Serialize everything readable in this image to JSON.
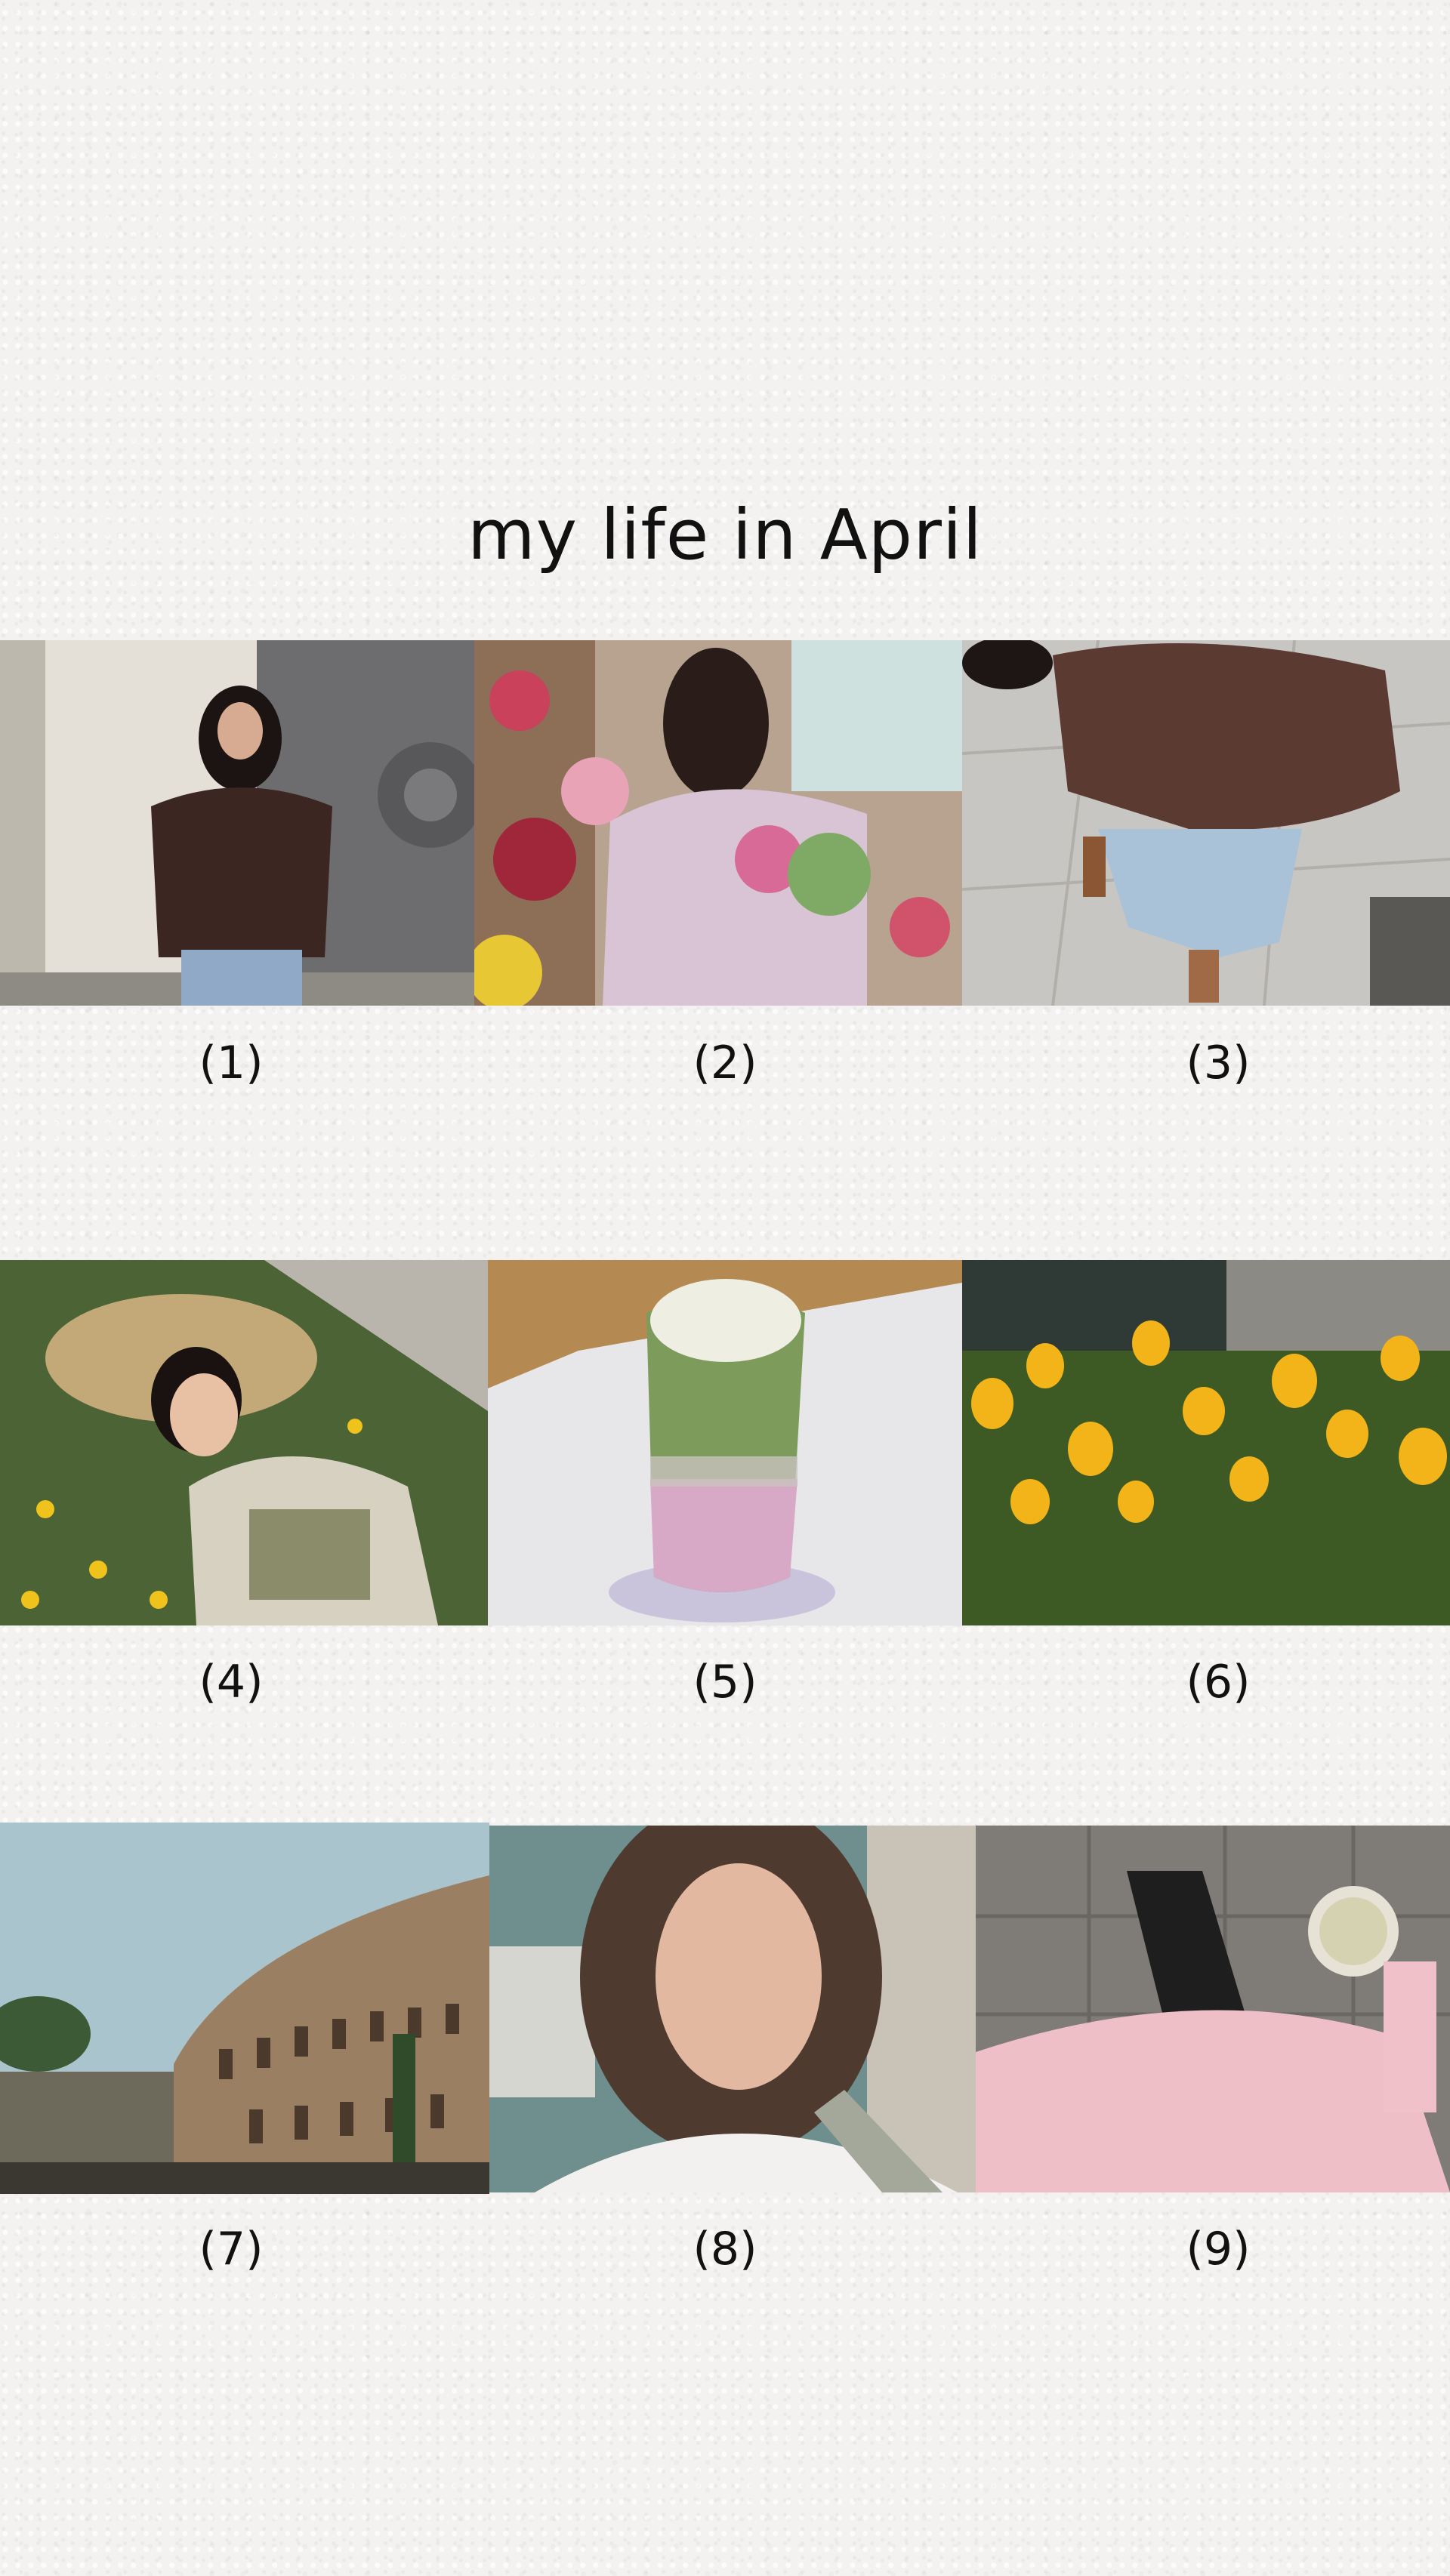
{
  "title": "my life in April",
  "photos": [
    {
      "caption": "(1)"
    },
    {
      "caption": "(2)"
    },
    {
      "caption": "(3)"
    },
    {
      "caption": "(4)"
    },
    {
      "caption": "(5)"
    },
    {
      "caption": "(6)"
    },
    {
      "caption": "(7)"
    },
    {
      "caption": "(8)"
    },
    {
      "caption": "(9)"
    }
  ]
}
